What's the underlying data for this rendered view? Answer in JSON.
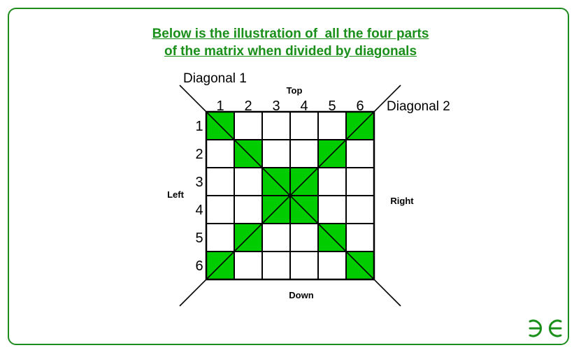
{
  "title": {
    "line1": "Below is the illustration of  all the four parts",
    "line2": "of the matrix when divided by diagonals"
  },
  "labels": {
    "diagonal1": "Diagonal 1",
    "diagonal2": "Diagonal 2",
    "top": "Top",
    "down": "Down",
    "left": "Left",
    "right": "Right"
  },
  "matrix": {
    "columns": [
      "1",
      "2",
      "3",
      "4",
      "5",
      "6"
    ],
    "rows": [
      "1",
      "2",
      "3",
      "4",
      "5",
      "6"
    ],
    "highlighted_cells": [
      [
        1,
        1
      ],
      [
        1,
        6
      ],
      [
        2,
        2
      ],
      [
        2,
        5
      ],
      [
        3,
        3
      ],
      [
        3,
        4
      ],
      [
        4,
        3
      ],
      [
        4,
        4
      ],
      [
        5,
        2
      ],
      [
        5,
        5
      ],
      [
        6,
        1
      ],
      [
        6,
        6
      ]
    ]
  },
  "colors": {
    "accent": "#1a8f1a",
    "cell_fill": "#00cc00",
    "frame": "#1e8c1e",
    "line": "#000000"
  },
  "logo": {
    "name": "gfg-logo"
  }
}
